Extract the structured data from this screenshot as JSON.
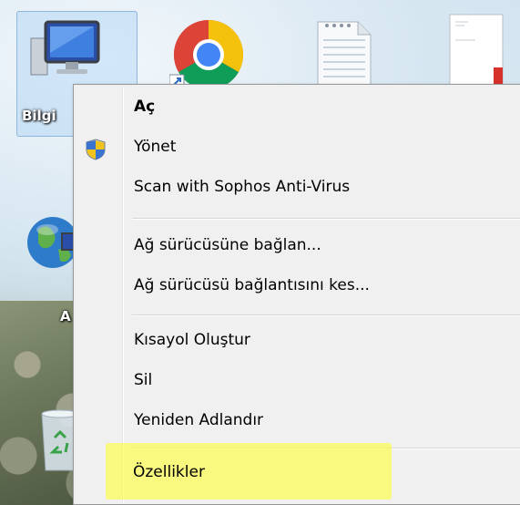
{
  "desktop": {
    "icons": [
      {
        "name": "computer",
        "label": "Bilgi",
        "selected": true
      },
      {
        "name": "chrome",
        "label": ""
      },
      {
        "name": "notepad",
        "label": ""
      },
      {
        "name": "document",
        "label": ""
      },
      {
        "name": "network",
        "label": "A"
      },
      {
        "name": "recycle-bin",
        "label": ""
      }
    ]
  },
  "context_menu": {
    "items": [
      {
        "label": "Aç",
        "bold": true,
        "icon": null
      },
      {
        "label": "Yönet",
        "bold": false,
        "icon": "shield-icon"
      },
      {
        "label": "Scan with Sophos Anti-Virus",
        "bold": false,
        "icon": null
      },
      {
        "label": "Ağ sürücüsüne bağlan...",
        "bold": false,
        "icon": null
      },
      {
        "label": "Ağ sürücüsü bağlantısını kes...",
        "bold": false,
        "icon": null
      },
      {
        "label": "Kısayol Oluştur",
        "bold": false,
        "icon": null
      },
      {
        "label": "Sil",
        "bold": false,
        "icon": null
      },
      {
        "label": "Yeniden Adlandır",
        "bold": false,
        "icon": null
      },
      {
        "label": "Özellikler",
        "bold": false,
        "icon": null,
        "highlighted": true
      }
    ],
    "highlight_color": "#ffff3c"
  }
}
